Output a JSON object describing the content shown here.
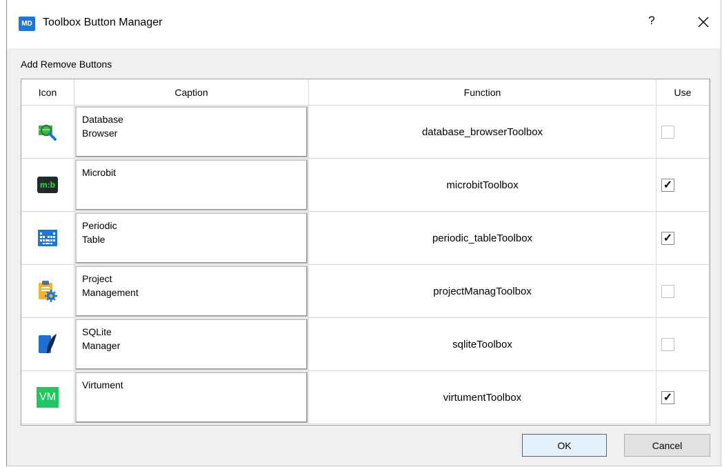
{
  "window": {
    "title": "Toolbox Button Manager",
    "app_icon_text": "MD",
    "help_label": "?"
  },
  "group_label": "Add Remove Buttons",
  "columns": [
    "Icon",
    "Caption",
    "Function",
    "Use"
  ],
  "rows": [
    {
      "icon": "database-browser-icon",
      "caption": "Database\nBrowser",
      "function": "database_browserToolbox",
      "use": false
    },
    {
      "icon": "microbit-icon",
      "icon_text": "m:b",
      "caption": "Microbit",
      "function": "microbitToolbox",
      "use": true
    },
    {
      "icon": "periodic-table-icon",
      "caption": "Periodic\nTable",
      "function": "periodic_tableToolbox",
      "use": true
    },
    {
      "icon": "project-management-icon",
      "caption": "Project\nManagement",
      "function": "projectManagToolbox",
      "use": false
    },
    {
      "icon": "sqlite-manager-icon",
      "caption": "SQLite\nManager",
      "function": "sqliteToolbox",
      "use": false
    },
    {
      "icon": "virtument-icon",
      "icon_text": "VM",
      "caption": "Virtument",
      "function": "virtumentToolbox",
      "use": true
    }
  ],
  "buttons": {
    "ok": "OK",
    "cancel": "Cancel"
  },
  "colors": {
    "accent": "#0078d7",
    "app_icon": "#1e77d3",
    "microbit_bg": "#1d2b2b",
    "microbit_fg": "#3ddc4a",
    "virtument": "#22c55e"
  }
}
